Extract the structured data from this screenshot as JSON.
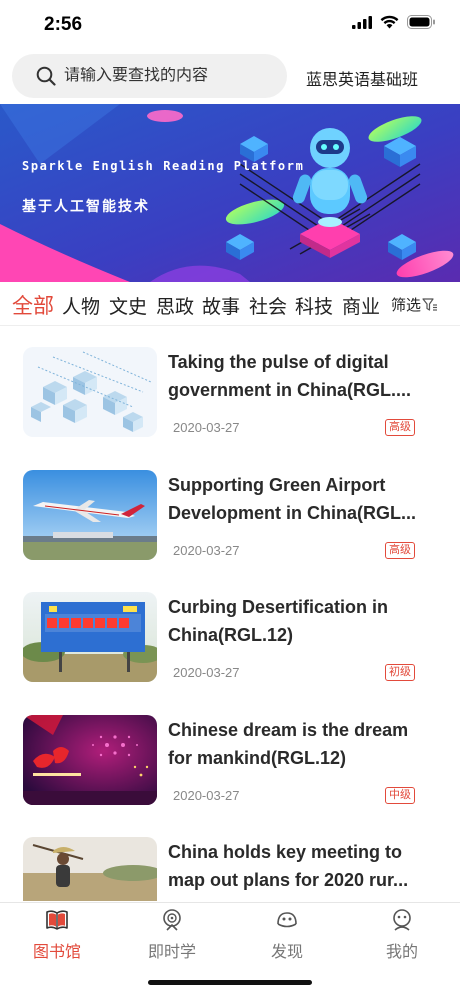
{
  "status_bar": {
    "time": "2:56"
  },
  "search": {
    "placeholder": "请输入要查找的内容"
  },
  "header": {
    "class_name": "蓝思英语基础班"
  },
  "banner": {
    "title_en": "Sparkle English Reading Platform",
    "title_cn": "基于人工智能技术"
  },
  "categories": {
    "items": [
      "全部",
      "人物",
      "文史",
      "思政",
      "故事",
      "社会",
      "科技",
      "商业"
    ],
    "active": "全部",
    "filter_label": "筛选"
  },
  "articles": [
    {
      "title_line1": "Taking the pulse of digital",
      "title_line2": "government in China(RGL....",
      "date": "2020-03-27",
      "level": "高级",
      "thumb": "cubes"
    },
    {
      "title_line1": "Supporting Green Airport",
      "title_line2": "Development in China(RGL...",
      "date": "2020-03-27",
      "level": "高级",
      "thumb": "airplane"
    },
    {
      "title_line1": "Curbing Desertification in",
      "title_line2": "China(RGL.12)",
      "date": "2020-03-27",
      "level": "初级",
      "thumb": "billboard"
    },
    {
      "title_line1": "Chinese dream is the dream",
      "title_line2": "for mankind(RGL.12)",
      "date": "2020-03-27",
      "level": "中级",
      "thumb": "fireworks"
    },
    {
      "title_line1": "China holds key meeting to",
      "title_line2": "map out plans for 2020 rur...",
      "date": "",
      "level": "",
      "thumb": "farmer"
    }
  ],
  "tabbar": {
    "items": [
      {
        "label": "图书馆",
        "icon": "book-icon",
        "active": true
      },
      {
        "label": "即时学",
        "icon": "learn-icon",
        "active": false
      },
      {
        "label": "发现",
        "icon": "discover-icon",
        "active": false
      },
      {
        "label": "我的",
        "icon": "profile-icon",
        "active": false
      }
    ]
  },
  "colors": {
    "accent": "#e24a3b",
    "banner_bg": "#3b3fc4"
  }
}
